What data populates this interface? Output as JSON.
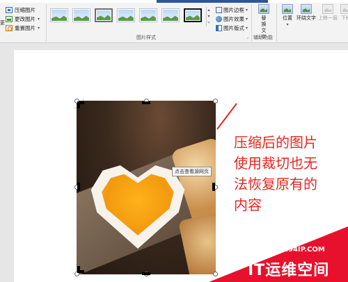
{
  "ribbon": {
    "adjust": {
      "partial_label": "更",
      "compress": "压缩图片",
      "change": "更改图片",
      "reset": "重置图片"
    },
    "styles": {
      "group_label": "图片样式",
      "border": "图片边框",
      "effects": "图片效果",
      "layout": "图片版式"
    },
    "accessibility": {
      "alt_text": "替换文字",
      "group_label": "辅助功能"
    },
    "arrange": {
      "position": "位置",
      "wrap_text": "环绕文字",
      "bring_forward": "上移一层",
      "send_backward": "下移"
    }
  },
  "document": {
    "tooltip": "点击查看源网页",
    "annotation_lines": [
      "压缩后的图片",
      "使用裁切也无",
      "法恢复原有的",
      "内容"
    ]
  },
  "watermark": {
    "url": "WWW.94IP.COM",
    "brand": "IT运维空间"
  },
  "colors": {
    "annotation": "#e8251e",
    "watermark": "#e8112d",
    "accent": "#2b579a"
  }
}
